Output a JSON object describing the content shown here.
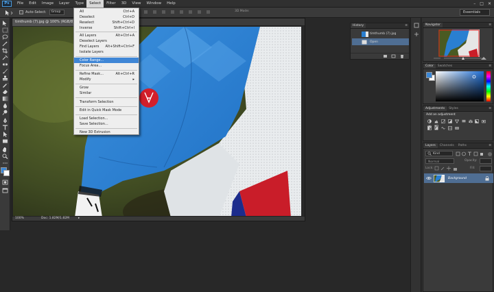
{
  "app": {
    "logo": "Ps"
  },
  "menubar": {
    "items": [
      "File",
      "Edit",
      "Image",
      "Layer",
      "Type",
      "Select",
      "Filter",
      "3D",
      "View",
      "Window",
      "Help"
    ],
    "active": "Select"
  },
  "window_controls": {
    "minimize": "–",
    "maximize": "□",
    "close": "✕"
  },
  "options_bar": {
    "auto_select_label": "Auto-Select:",
    "auto_select_value": "Group",
    "mode_3d_label": "3D Mode:",
    "workspace": "Essentials"
  },
  "document": {
    "tab_title": "timthumb (7).jpg @ 100% (RGB/8)",
    "tab_close": "×",
    "zoom": "100%",
    "doc_size": "Doc: 1.82M/1.82M"
  },
  "select_menu": {
    "items": [
      {
        "label": "All",
        "shortcut": "Ctrl+A",
        "disabled": false
      },
      {
        "label": "Deselect",
        "shortcut": "Ctrl+D",
        "disabled": false
      },
      {
        "label": "Reselect",
        "shortcut": "Shift+Ctrl+D",
        "disabled": false
      },
      {
        "label": "Inverse",
        "shortcut": "Shift+Ctrl+I",
        "disabled": false
      },
      {
        "label": "All Layers",
        "shortcut": "Alt+Ctrl+A",
        "disabled": false
      },
      {
        "label": "Deselect Layers",
        "shortcut": "",
        "disabled": false
      },
      {
        "label": "Find Layers",
        "shortcut": "Alt+Shift+Ctrl+F",
        "disabled": false
      },
      {
        "label": "Isolate Layers",
        "shortcut": "",
        "disabled": false
      },
      {
        "label": "Color Range...",
        "shortcut": "",
        "disabled": false,
        "highlight": true
      },
      {
        "label": "Focus Area...",
        "shortcut": "",
        "disabled": false
      },
      {
        "label": "Refine Mask...",
        "shortcut": "Alt+Ctrl+R",
        "disabled": false
      },
      {
        "label": "Modify",
        "shortcut": "▸",
        "disabled": false
      },
      {
        "label": "Grow",
        "shortcut": "",
        "disabled": false
      },
      {
        "label": "Similar",
        "shortcut": "",
        "disabled": false
      },
      {
        "label": "Transform Selection",
        "shortcut": "",
        "disabled": false
      },
      {
        "label": "Edit in Quick Mask Mode",
        "shortcut": "",
        "disabled": false
      },
      {
        "label": "Load Selection...",
        "shortcut": "",
        "disabled": false
      },
      {
        "label": "Save Selection...",
        "shortcut": "",
        "disabled": false
      },
      {
        "label": "New 3D Extrusion",
        "shortcut": "",
        "disabled": false
      }
    ]
  },
  "history_panel": {
    "tab": "History",
    "snapshot_name": "timthumb (7).jpg",
    "rows": [
      "Open"
    ]
  },
  "navigator_panel": {
    "tabs": [
      "Navigator"
    ]
  },
  "color_panel": {
    "tabs": [
      "Color",
      "Swatches"
    ],
    "fg_color": "#3b87d6",
    "bg_color": "#ffffff"
  },
  "adjustments_panel": {
    "tabs": [
      "Adjustments",
      "Styles"
    ],
    "heading": "Add an adjustment"
  },
  "layers_panel": {
    "tabs": [
      "Layers",
      "Channels",
      "Paths"
    ],
    "filter_kind": "Kind",
    "blend_mode": "Normal",
    "opacity_label": "Opacity:",
    "lock_label": "Lock:",
    "fill_label": "Fill:",
    "layers": [
      {
        "name": "Background",
        "visible": true,
        "locked": true
      }
    ]
  },
  "colors": {
    "accent": "#3f86d6",
    "jersey_blue": "#2a7fd1",
    "menu_bg": "#eeeeee",
    "panel_bg": "#3a3a3a"
  }
}
